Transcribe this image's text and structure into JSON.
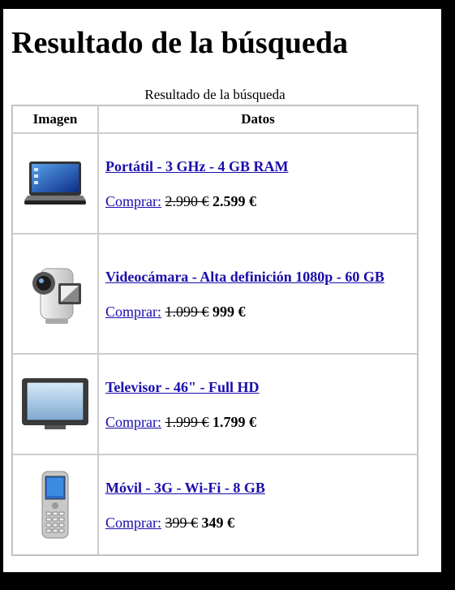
{
  "page": {
    "title": "Resultado de la búsqueda",
    "table_caption": "Resultado de la búsqueda",
    "columns": {
      "image": "Imagen",
      "data": "Datos"
    }
  },
  "products": [
    {
      "name": "Portátil - 3 GHz - 4 GB RAM",
      "buy_label": "Comprar:",
      "old_price": "2.990 €",
      "new_price": "2.599 €",
      "icon": "laptop-icon"
    },
    {
      "name": "Videocámara - Alta definición 1080p - 60 GB",
      "buy_label": "Comprar:",
      "old_price": "1.099 €",
      "new_price": "999 €",
      "icon": "camcorder-icon"
    },
    {
      "name": "Televisor - 46\" - Full HD",
      "buy_label": "Comprar:",
      "old_price": "1.999 €",
      "new_price": "1.799 €",
      "icon": "television-icon"
    },
    {
      "name": "Móvil - 3G - Wi-Fi - 8 GB",
      "buy_label": "Comprar:",
      "old_price": "399 €",
      "new_price": "349 €",
      "icon": "mobile-phone-icon"
    }
  ],
  "colors": {
    "link": "#1a0dab",
    "frame": "#000000",
    "border": "#cccccc"
  }
}
